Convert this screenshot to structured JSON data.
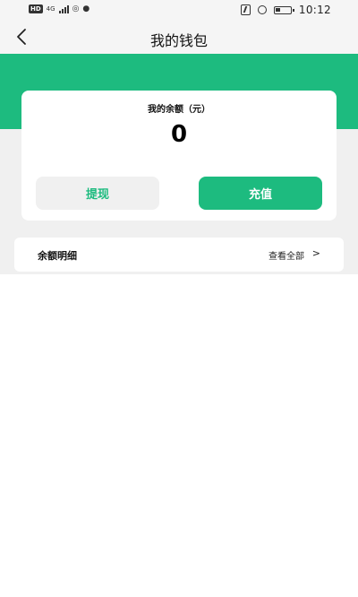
{
  "status_bar": {
    "network_label": "4G",
    "clock": "10:12"
  },
  "header": {
    "title": "我的钱包"
  },
  "wallet": {
    "balance_label": "我的余额（元）",
    "balance_value": "0",
    "withdraw_label": "提现",
    "recharge_label": "充值"
  },
  "details": {
    "title": "余额明细",
    "view_all_label": "查看全部",
    "chevron": ">"
  },
  "colors": {
    "accent": "#1dbb7f",
    "page_background": "#f0f0f0",
    "card": "#ffffff"
  },
  "icons": [
    "back-icon",
    "signal-icon",
    "wifi-icon",
    "wechat-icon",
    "nfc-icon",
    "alarm-icon",
    "battery-icon",
    "chevron-right-icon"
  ]
}
